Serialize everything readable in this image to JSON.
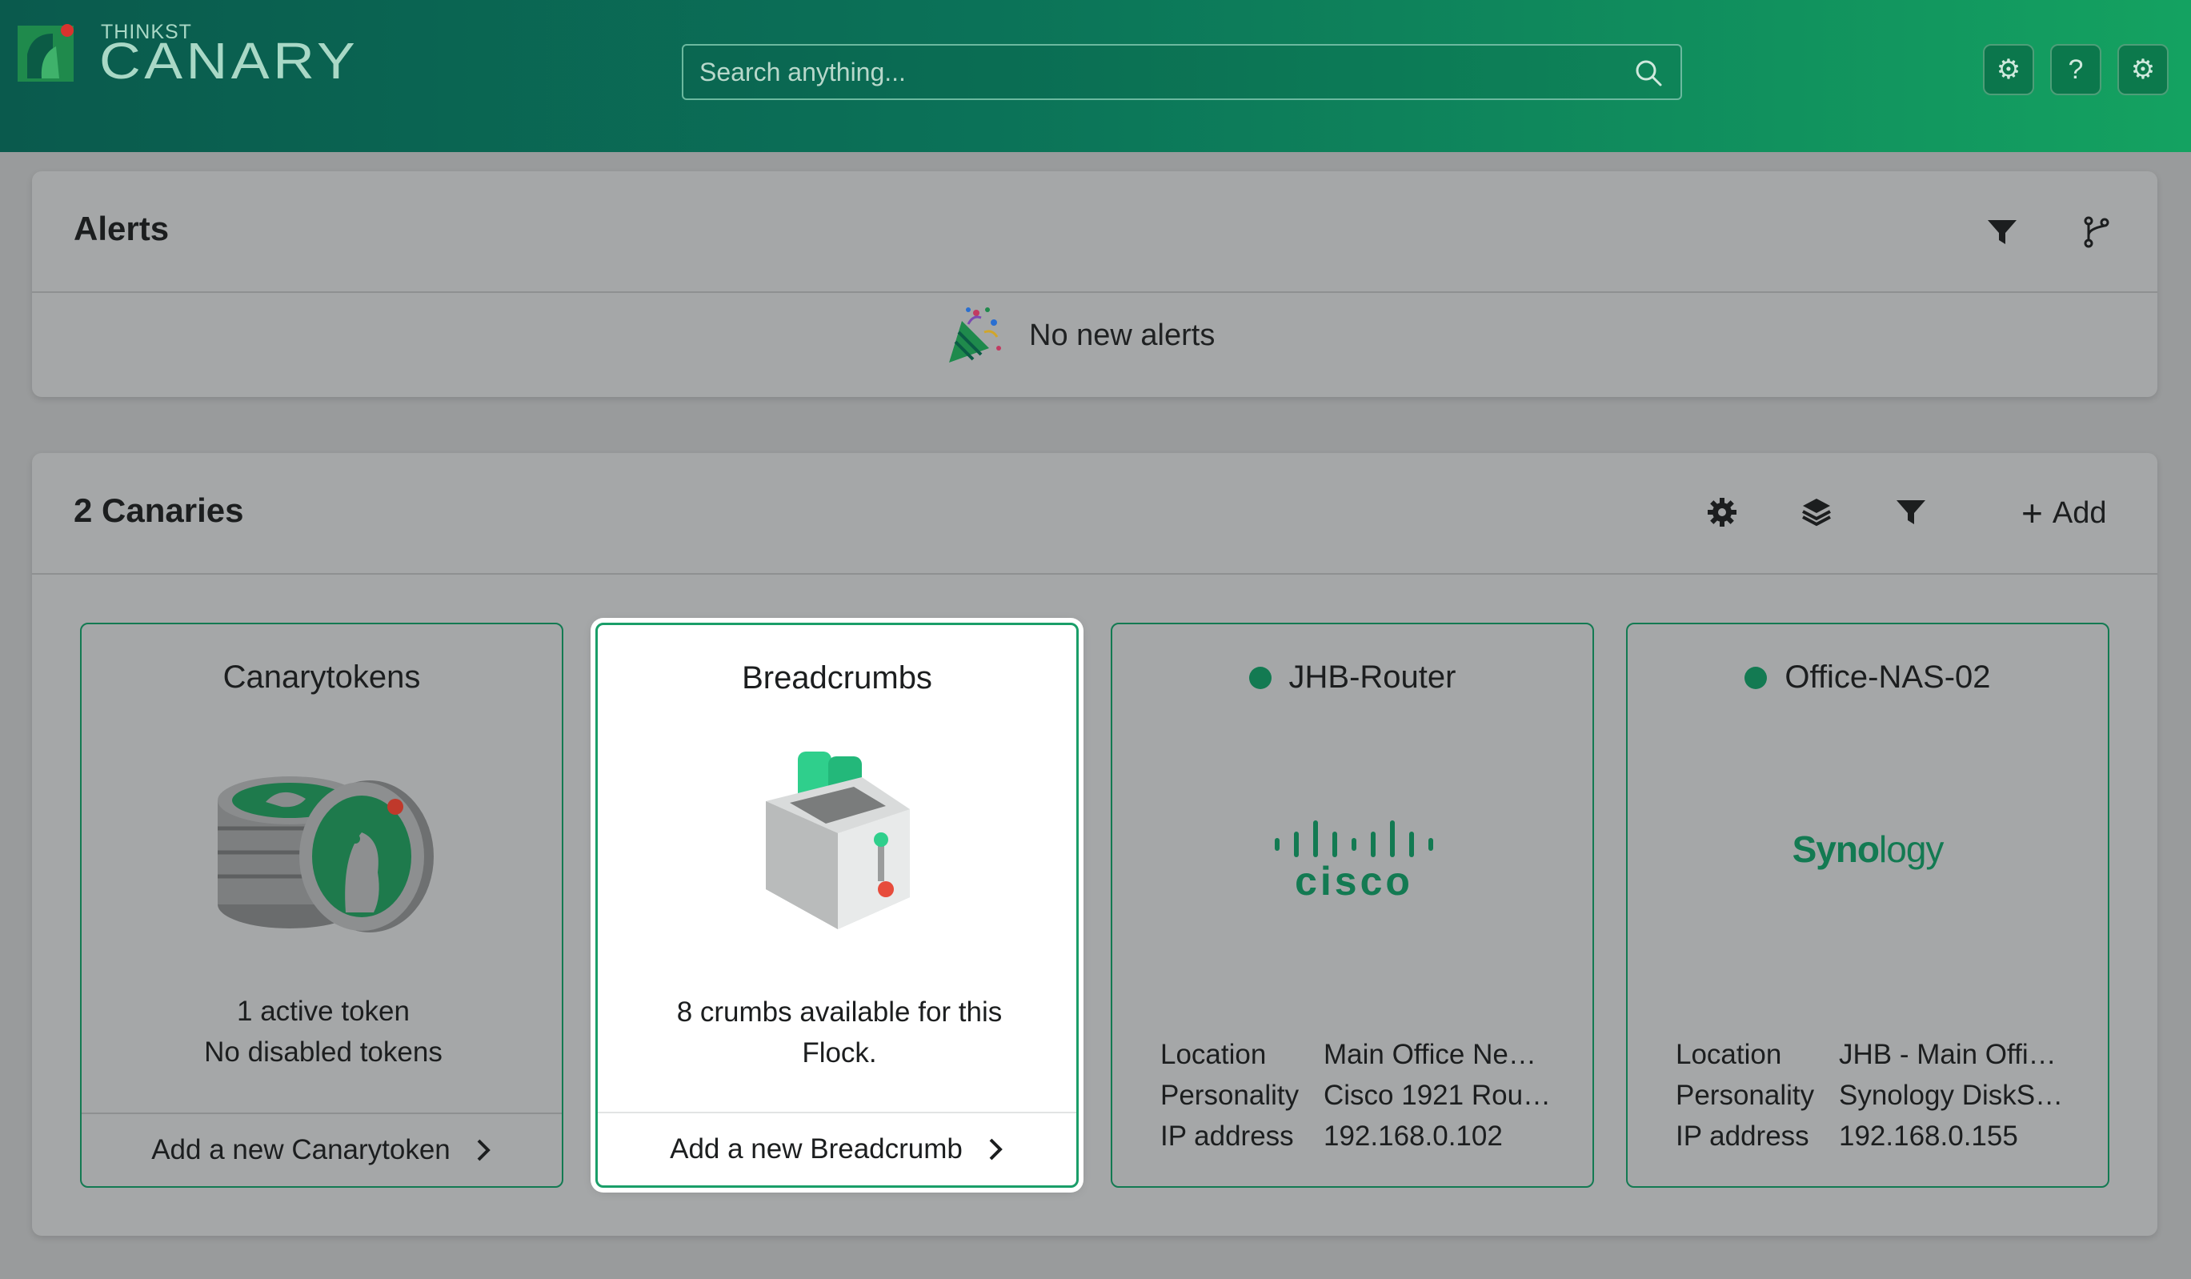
{
  "header": {
    "brand_small": "THINKST",
    "brand_big": "CANARY",
    "search_placeholder": "Search anything...",
    "buttons": [
      {
        "icon": "gear-icon",
        "glyph": "⚙"
      },
      {
        "icon": "help-icon",
        "glyph": "?"
      },
      {
        "icon": "settings-icon",
        "glyph": "⚙"
      }
    ]
  },
  "alerts": {
    "title": "Alerts",
    "empty_message": "No new alerts",
    "tools": [
      "filter-icon",
      "branch-icon"
    ]
  },
  "canaries": {
    "title": "2 Canaries",
    "tools": [
      "gear-icon",
      "layers-icon",
      "filter-icon"
    ],
    "add_label": "Add",
    "add_glyph": "+",
    "cards": [
      {
        "title": "Canarytokens",
        "desc_line1": "1 active token",
        "desc_line2": "No disabled tokens",
        "footer": "Add a new Canarytoken"
      },
      {
        "title": "Breadcrumbs",
        "desc_line1": "8 crumbs available for this",
        "desc_line2": "Flock.",
        "footer": "Add a new Breadcrumb"
      },
      {
        "title": "JHB-Router",
        "status": "online",
        "logo_text": "cisco",
        "info": [
          {
            "key": "Location",
            "value": "Main Office Ne…"
          },
          {
            "key": "Personality",
            "value": "Cisco 1921 Rou…"
          },
          {
            "key": "IP address",
            "value": "192.168.0.102"
          }
        ]
      },
      {
        "title": "Office-NAS-02",
        "status": "online",
        "logo_bold": "Syno",
        "logo_light": "logy",
        "info": [
          {
            "key": "Location",
            "value": "JHB - Main Offi…"
          },
          {
            "key": "Personality",
            "value": "Synology DiskS…"
          },
          {
            "key": "IP address",
            "value": "192.168.0.155"
          }
        ]
      }
    ]
  },
  "colors": {
    "header_start": "#0a5a4d",
    "header_end": "#14a261",
    "accent": "#137a52",
    "backdrop": "#999b9c"
  }
}
